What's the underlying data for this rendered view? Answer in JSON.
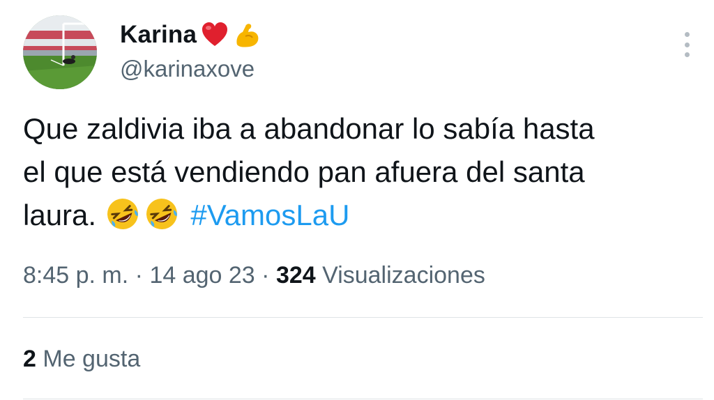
{
  "author": {
    "display_name": "Karina",
    "handle": "@karinaxove",
    "name_emojis": [
      "red-heart-icon",
      "flexed-biceps-icon"
    ],
    "avatar": "soccer-field-avatar"
  },
  "tweet": {
    "text_line1": "Que zaldivia iba a abandonar lo sabía hasta",
    "text_line2": "el que está vendiendo pan afuera del santa",
    "text_line3": "laura.",
    "emojis": [
      "rolling-on-floor-laughing-icon",
      "rolling-on-floor-laughing-icon"
    ],
    "hashtag": "#VamosLaU"
  },
  "meta": {
    "time": "8:45 p. m.",
    "sep1": "·",
    "date": "14 ago 23",
    "sep2": "·",
    "views_count": "324",
    "views_label": "Visualizaciones"
  },
  "engagement": {
    "likes_count": "2",
    "likes_label": "Me gusta"
  },
  "colors": {
    "text": "#0f1419",
    "secondary": "#536471",
    "link": "#1d9bf0",
    "divider": "#dfe3e6"
  }
}
